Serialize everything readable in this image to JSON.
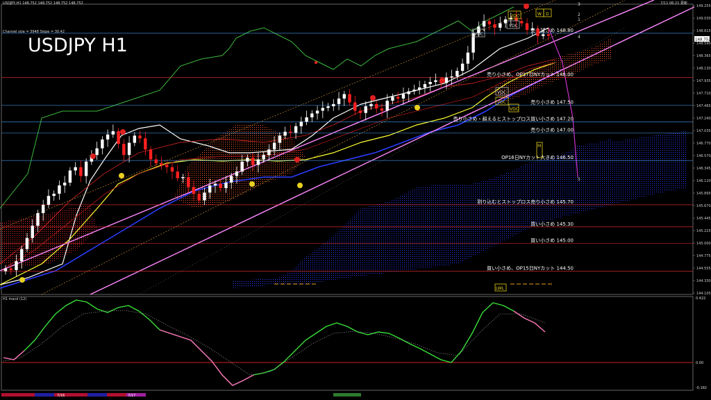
{
  "header": {
    "symbol_line": "USDJPY,H1  148.752 148.752 148.752 148.752",
    "timestamp": "7/11 06:21 更新",
    "channel_info": "Channel size = 3948 Slope = 30.42",
    "big_title": "USDJPY H1"
  },
  "macd_panel": {
    "label": "H1  macd (12)",
    "scale_top": "0.422",
    "scale_zero": "0.00",
    "scale_bottom": "-0.182"
  },
  "bottom_bar": {
    "date_a": "7/16",
    "date_b": "7/17"
  },
  "channel_numbers": [
    "3",
    "2",
    "1",
    "4",
    "5"
  ],
  "badges": [
    "VDC",
    "VDC",
    "VDC",
    "VDC",
    "VDC",
    "VDC",
    "M",
    "W",
    "D",
    "LWL"
  ],
  "chart_data": {
    "type": "candlestick",
    "symbol": "USDJPY",
    "timeframe": "H1",
    "ylim": [
      144.105,
      149.3
    ],
    "y_ticks": [
      "149.255",
      "149.030",
      "148.815",
      "148.590",
      "148.365",
      "148.130",
      "147.935",
      "147.710",
      "147.465",
      "147.240",
      "147.035",
      "146.770",
      "146.570",
      "146.345",
      "146.120",
      "145.895",
      "145.670",
      "145.445",
      "145.225",
      "145.000",
      "144.775",
      "144.555",
      "144.330",
      "144.105"
    ],
    "price_tag": "148.752",
    "ohlc_trend": [
      144.55,
      144.52,
      144.68,
      144.9,
      145.1,
      145.32,
      145.55,
      145.7,
      145.86,
      145.9,
      146.05,
      146.1,
      146.32,
      146.38,
      146.22,
      146.48,
      146.6,
      146.72,
      146.88,
      146.97,
      147.03,
      146.8,
      146.6,
      146.82,
      146.95,
      146.9,
      146.7,
      146.52,
      146.45,
      146.42,
      146.38,
      146.3,
      146.18,
      146.2,
      146.02,
      145.9,
      145.78,
      145.92,
      146.05,
      146.08,
      146.0,
      146.1,
      146.22,
      146.3,
      146.48,
      146.55,
      146.42,
      146.52,
      146.6,
      146.7,
      146.82,
      146.95,
      147.02,
      147.0,
      147.12,
      147.2,
      147.28,
      147.35,
      147.4,
      147.45,
      147.48,
      147.52,
      147.62,
      147.7,
      147.55,
      147.4,
      147.36,
      147.48,
      147.52,
      147.44,
      147.4,
      147.58,
      147.65,
      147.62,
      147.7,
      147.75,
      147.78,
      147.82,
      147.88,
      147.92,
      147.95,
      147.9,
      148.0,
      148.02,
      148.12,
      148.25,
      148.45,
      148.8,
      148.92,
      149.02,
      148.96,
      148.9,
      148.98,
      149.05,
      149.08,
      149.02,
      148.98,
      148.86,
      148.88,
      148.75,
      148.78,
      148.752
    ],
    "levels": [
      {
        "price": 148.8,
        "label": "売り試さめ 148.80",
        "color": "#4aa3ff"
      },
      {
        "price": 148.0,
        "label": "売り小さめ、OP17日NYカット 148.00",
        "color": "#ff3333"
      },
      {
        "price": 147.5,
        "label": "売り小さめ 147.50",
        "color": "#4aa3ff"
      },
      {
        "price": 147.2,
        "label": "売り小さめ・超えるとストップロス買い小さめ 147.20",
        "color": "#4aa3ff"
      },
      {
        "price": 147.0,
        "label": "売り小さめ 147.00",
        "color": "#4aa3ff"
      },
      {
        "price": 146.5,
        "label": "OP16日NYカット大きめ 146.50",
        "color": "#4aa3ff"
      },
      {
        "price": 145.7,
        "label": "割り込むとストップロス売り小さめ 145.70",
        "color": "#ff3333"
      },
      {
        "price": 145.3,
        "label": "買い小さめ 145.30",
        "color": "#ff3333"
      },
      {
        "price": 145.0,
        "label": "買い小さめ 145.00",
        "color": "#ff3333"
      },
      {
        "price": 144.5,
        "label": "買い小さめ、OP15日NYカット 144.50",
        "color": "#ff3333"
      }
    ]
  }
}
